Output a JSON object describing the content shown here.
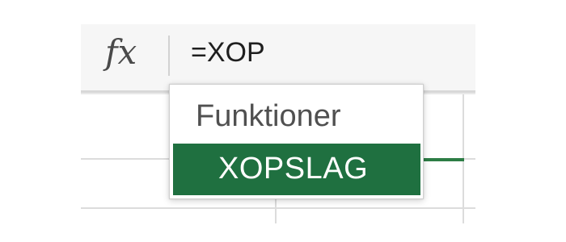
{
  "formula_bar": {
    "fx_label": "fx",
    "input_value": "=XOP"
  },
  "autocomplete": {
    "header": "Funktioner",
    "items": [
      {
        "label": "XOPSLAG",
        "selected": true
      }
    ]
  },
  "colors": {
    "selected_item_bg": "#1f7040",
    "selected_cell_border": "#2d7d45",
    "formula_bar_bg": "#f6f6f6"
  }
}
